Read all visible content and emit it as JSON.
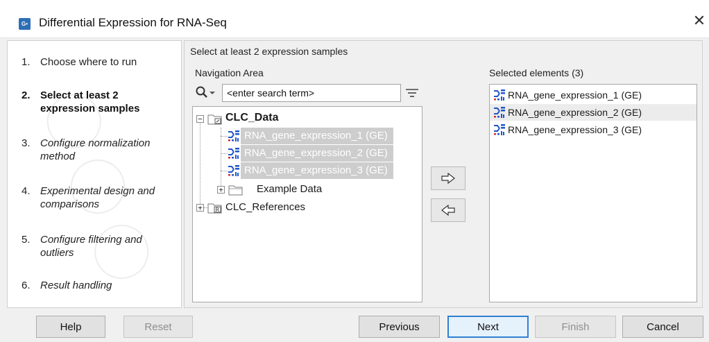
{
  "window": {
    "title": "Differential Expression for RNA-Seq",
    "app_icon_text": "G•"
  },
  "steps": [
    {
      "num": "1.",
      "label": "Choose where to run",
      "state": "done"
    },
    {
      "num": "2.",
      "label": "Select at least 2 expression samples",
      "state": "current"
    },
    {
      "num": "3.",
      "label": "Configure normalization method",
      "state": "future"
    },
    {
      "num": "4.",
      "label": "Experimental design and comparisons",
      "state": "future"
    },
    {
      "num": "5.",
      "label": "Configure filtering and outliers",
      "state": "future"
    },
    {
      "num": "6.",
      "label": "Result handling",
      "state": "future"
    }
  ],
  "main": {
    "section_title": "Select at least 2 expression samples",
    "navigation_label": "Navigation Area",
    "search": {
      "value": "<enter search term>",
      "placeholder": "<enter search term>"
    },
    "tree": {
      "root": "CLC_Data",
      "items": [
        "RNA_gene_expression_1 (GE)",
        "RNA_gene_expression_2 (GE)",
        "RNA_gene_expression_3 (GE)"
      ],
      "example_folder": "Example Data",
      "references": "CLC_References"
    },
    "selected_label": "Selected elements (3)",
    "selected_items": [
      "RNA_gene_expression_1 (GE)",
      "RNA_gene_expression_2 (GE)",
      "RNA_gene_expression_3 (GE)"
    ]
  },
  "buttons": {
    "help": "Help",
    "reset": "Reset",
    "previous": "Previous",
    "next": "Next",
    "finish": "Finish",
    "cancel": "Cancel"
  },
  "colors": {
    "accent": "#2f7fd4",
    "selection": "#cdcdcd",
    "app_icon": "#2d6fb5"
  }
}
